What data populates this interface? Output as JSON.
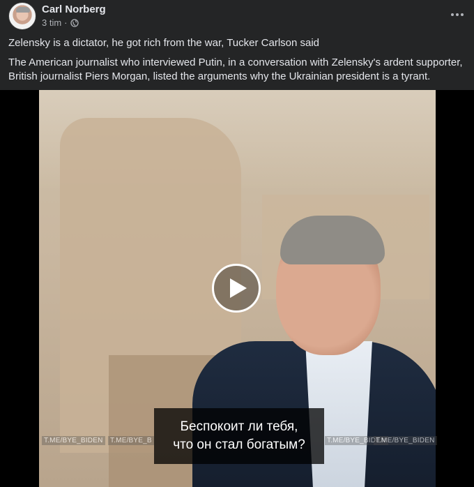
{
  "post": {
    "author": "Carl Norberg",
    "time": "3 tim",
    "separator": "·",
    "icons": {
      "audience": "globe-icon",
      "more": "more-options-icon"
    },
    "paragraphs": [
      "Zelensky is a dictator, he got rich from the war, Tucker Carlson said",
      "The American journalist who interviewed Putin, in a conversation with Zelensky's ardent supporter, British journalist Piers Morgan, listed the arguments why the Ukrainian president is a tyrant."
    ]
  },
  "video": {
    "subtitle_line1": "Беспокоит ли тебя,",
    "subtitle_line2": "что он стал богатым?",
    "watermarks": [
      "T.ME/BYE_BIDEN",
      "T.ME/BYE_B",
      "T.ME/BYE_BIDEN",
      "T.ME/BYE_BIDEN"
    ],
    "play_icon": "play-icon"
  }
}
